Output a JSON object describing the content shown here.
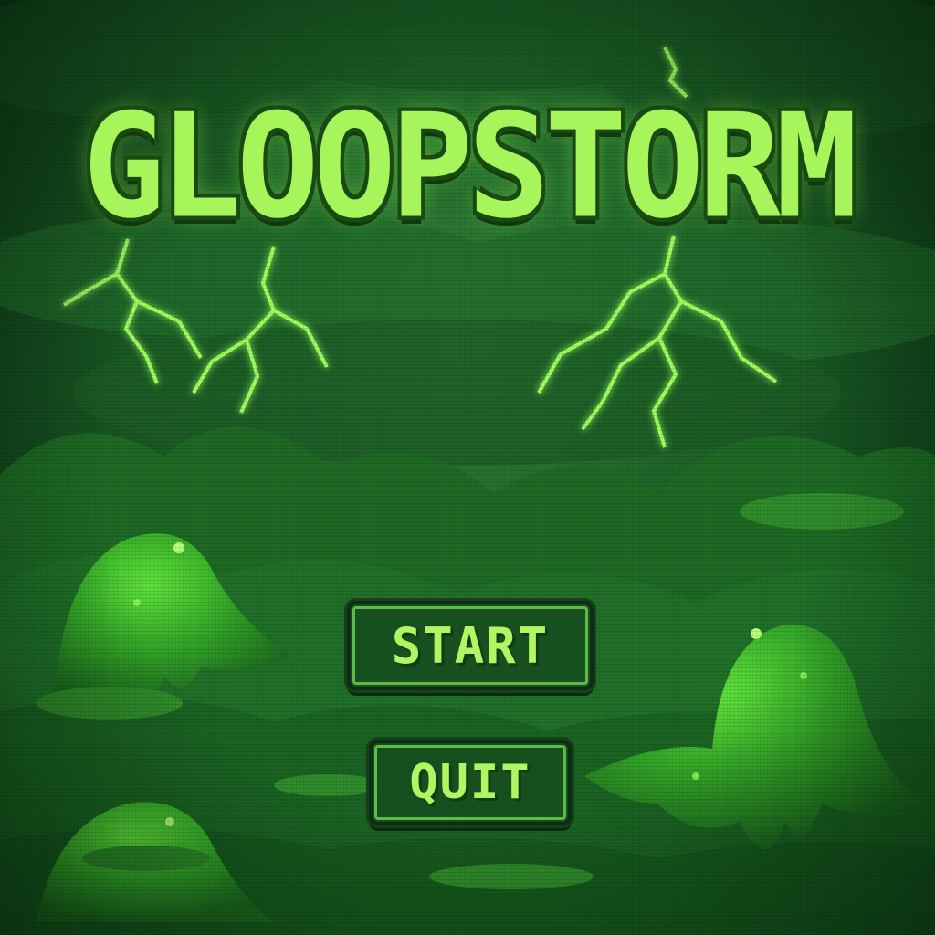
{
  "title": "GLOOPSTORM",
  "menu": {
    "start_label": "START",
    "quit_label": "QUIT"
  },
  "colors": {
    "title": "#a6f55a",
    "button_text": "#b2f563",
    "lightning": "#9dff5c",
    "slime": "#3fbf2a",
    "background": "#1f6429"
  }
}
